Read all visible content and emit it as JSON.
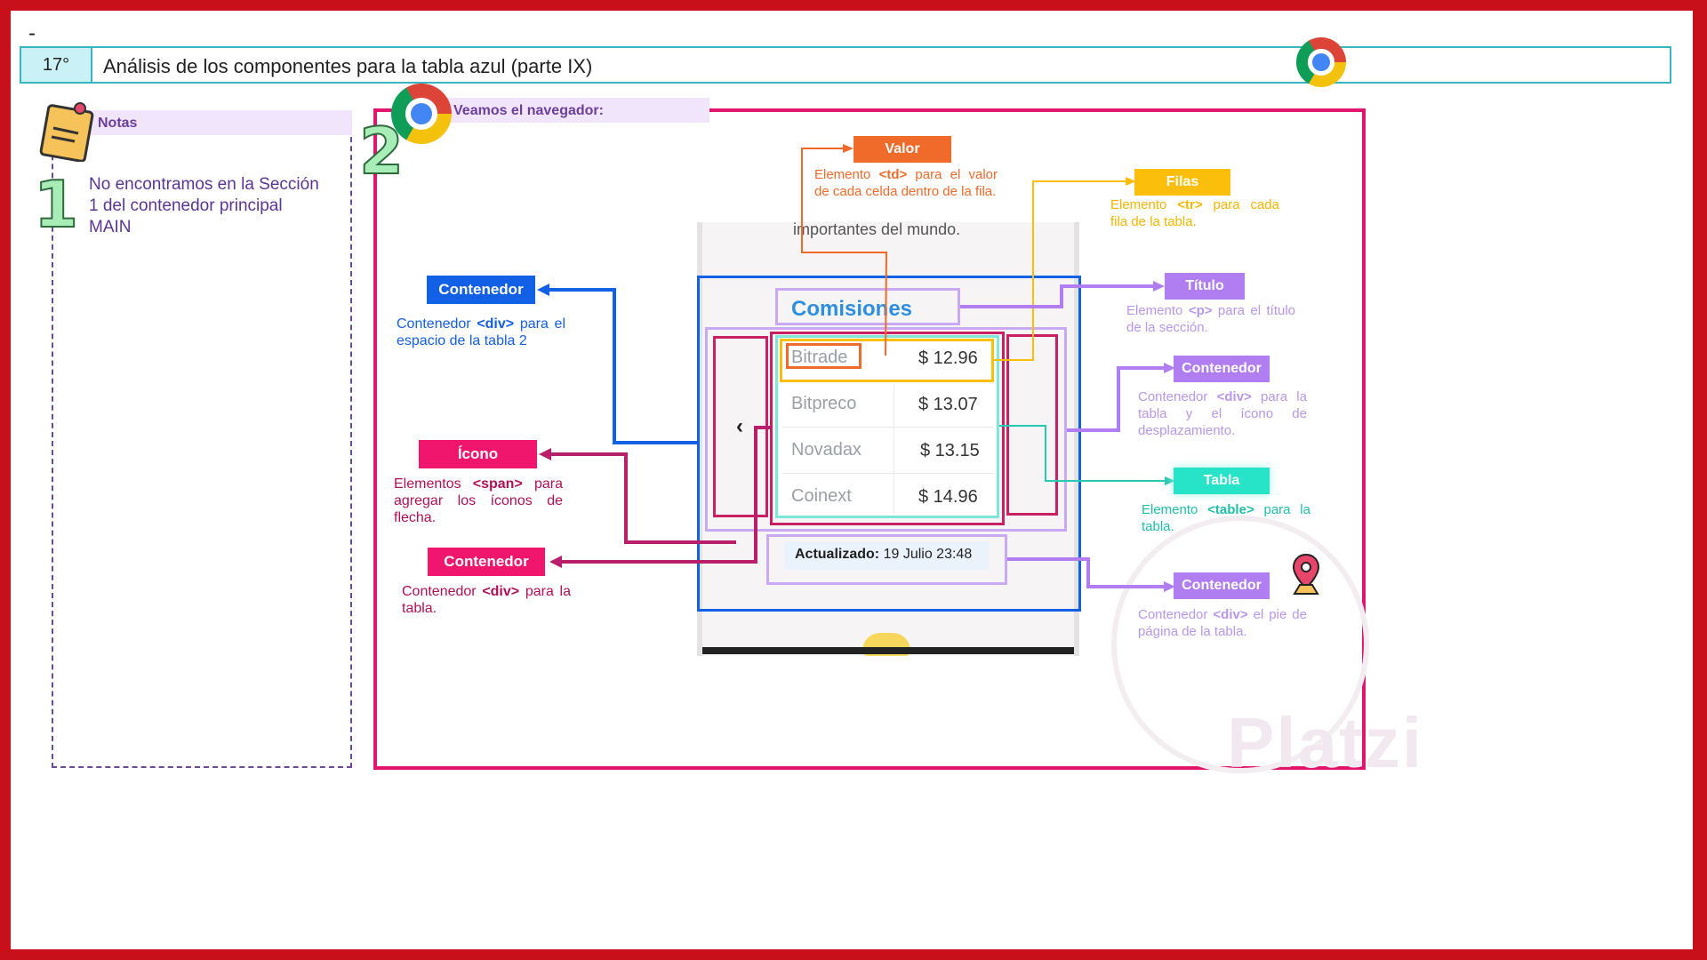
{
  "header": {
    "dash": "-",
    "number": "17°",
    "title": "Análisis de los componentes para la tabla azul (parte IX)"
  },
  "notes": {
    "title": "Notas",
    "step": "1",
    "text": "No encontramos en la Sección 1 del contenedor principal MAIN"
  },
  "browser": {
    "title": "Veamos el navegador:",
    "step": "2",
    "partial_line": "importantes del mundo.",
    "table_title": "Comisiones",
    "arrow_left": "‹",
    "rows": [
      {
        "name": "Bitrade",
        "price": "$ 12.96"
      },
      {
        "name": "Bitpreco",
        "price": "$ 13.07"
      },
      {
        "name": "Novadax",
        "price": "$ 13.15"
      },
      {
        "name": "Coinext",
        "price": "$ 14.96"
      }
    ],
    "updated_label": "Actualizado:",
    "updated_value": "19 Julio 23:48"
  },
  "annotations": {
    "valor": {
      "label": "Valor",
      "pre": "Elemento ",
      "tag": "<td>",
      "post": " para el valor de cada celda dentro de la fila."
    },
    "filas": {
      "label": "Filas",
      "pre": "Elemento ",
      "tag": "<tr>",
      "post": " para cada fila de la tabla."
    },
    "titulo": {
      "label": "Título",
      "pre": "Elemento ",
      "tag": "<p>",
      "post": " para el título de la sección."
    },
    "contenedor_tabla_icono": {
      "label": "Contenedor",
      "pre": "Contenedor ",
      "tag": "<div>",
      "post": " para la tabla y el ícono de desplazamiento."
    },
    "tabla": {
      "label": "Tabla",
      "pre": "Elemento ",
      "tag": "<table>",
      "post": " para la tabla."
    },
    "contenedor_pie": {
      "label": "Contenedor",
      "pre": "Contenedor ",
      "tag": "<div>",
      "post": " el pie de página de la tabla."
    },
    "contenedor_espacio": {
      "label": "Contenedor",
      "pre": "Contenedor ",
      "tag": "<div>",
      "post": " para el espacio de la tabla 2"
    },
    "icono": {
      "label": "Ícono",
      "pre": "Elementos ",
      "tag": "<span>",
      "post": " para agregar los íconos de flecha."
    },
    "contenedor_tabla": {
      "label": "Contenedor",
      "pre": "Contenedor ",
      "tag": "<div>",
      "post": " para la tabla."
    }
  },
  "watermark": "Platzi",
  "colors": {
    "frame": "#c8101a",
    "header_border": "#37b5c0",
    "notes_purple": "#6b3f9c",
    "browser_border": "#e0156b",
    "blue": "#1260e6",
    "orange": "#f06a2a",
    "yellow": "#fbbf0b",
    "violet": "#b07ef0",
    "teal": "#27e3c8",
    "magenta": "#e61a6a"
  },
  "icons": [
    "sticky-note-icon",
    "chrome-icon",
    "map-pin-icon",
    "chevron-left-icon"
  ]
}
